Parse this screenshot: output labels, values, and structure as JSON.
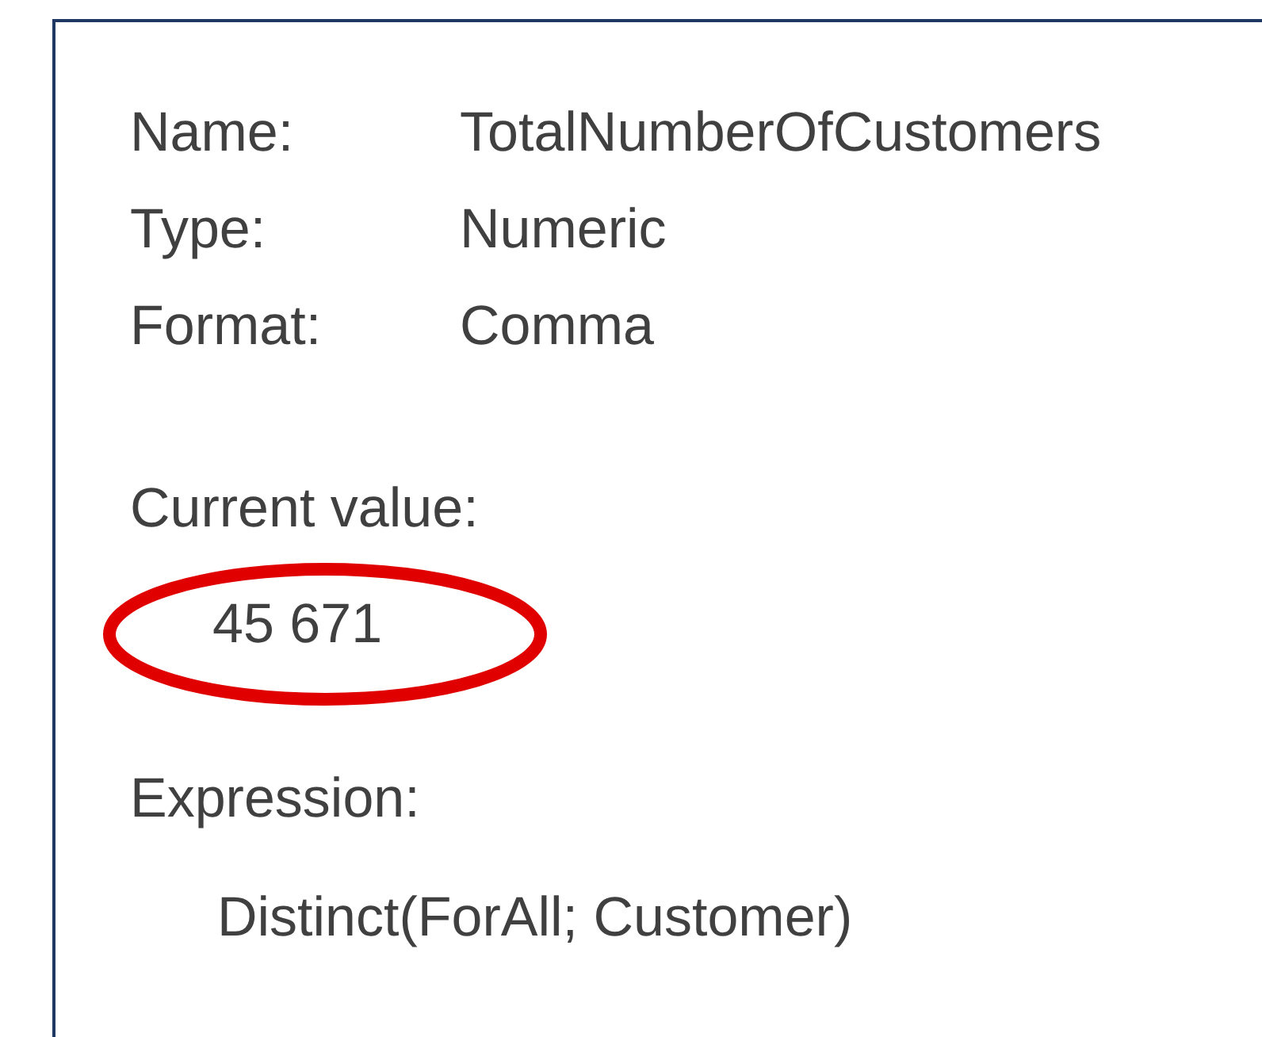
{
  "fields": [
    {
      "label": "Name:",
      "value": "TotalNumberOfCustomers"
    },
    {
      "label": "Type:",
      "value": "Numeric"
    },
    {
      "label": "Format:",
      "value": "Comma"
    }
  ],
  "current_value": {
    "label": "Current value:",
    "value": "45 671",
    "circled": true
  },
  "expression": {
    "label": "Expression:",
    "value": "Distinct(ForAll; Customer)"
  }
}
